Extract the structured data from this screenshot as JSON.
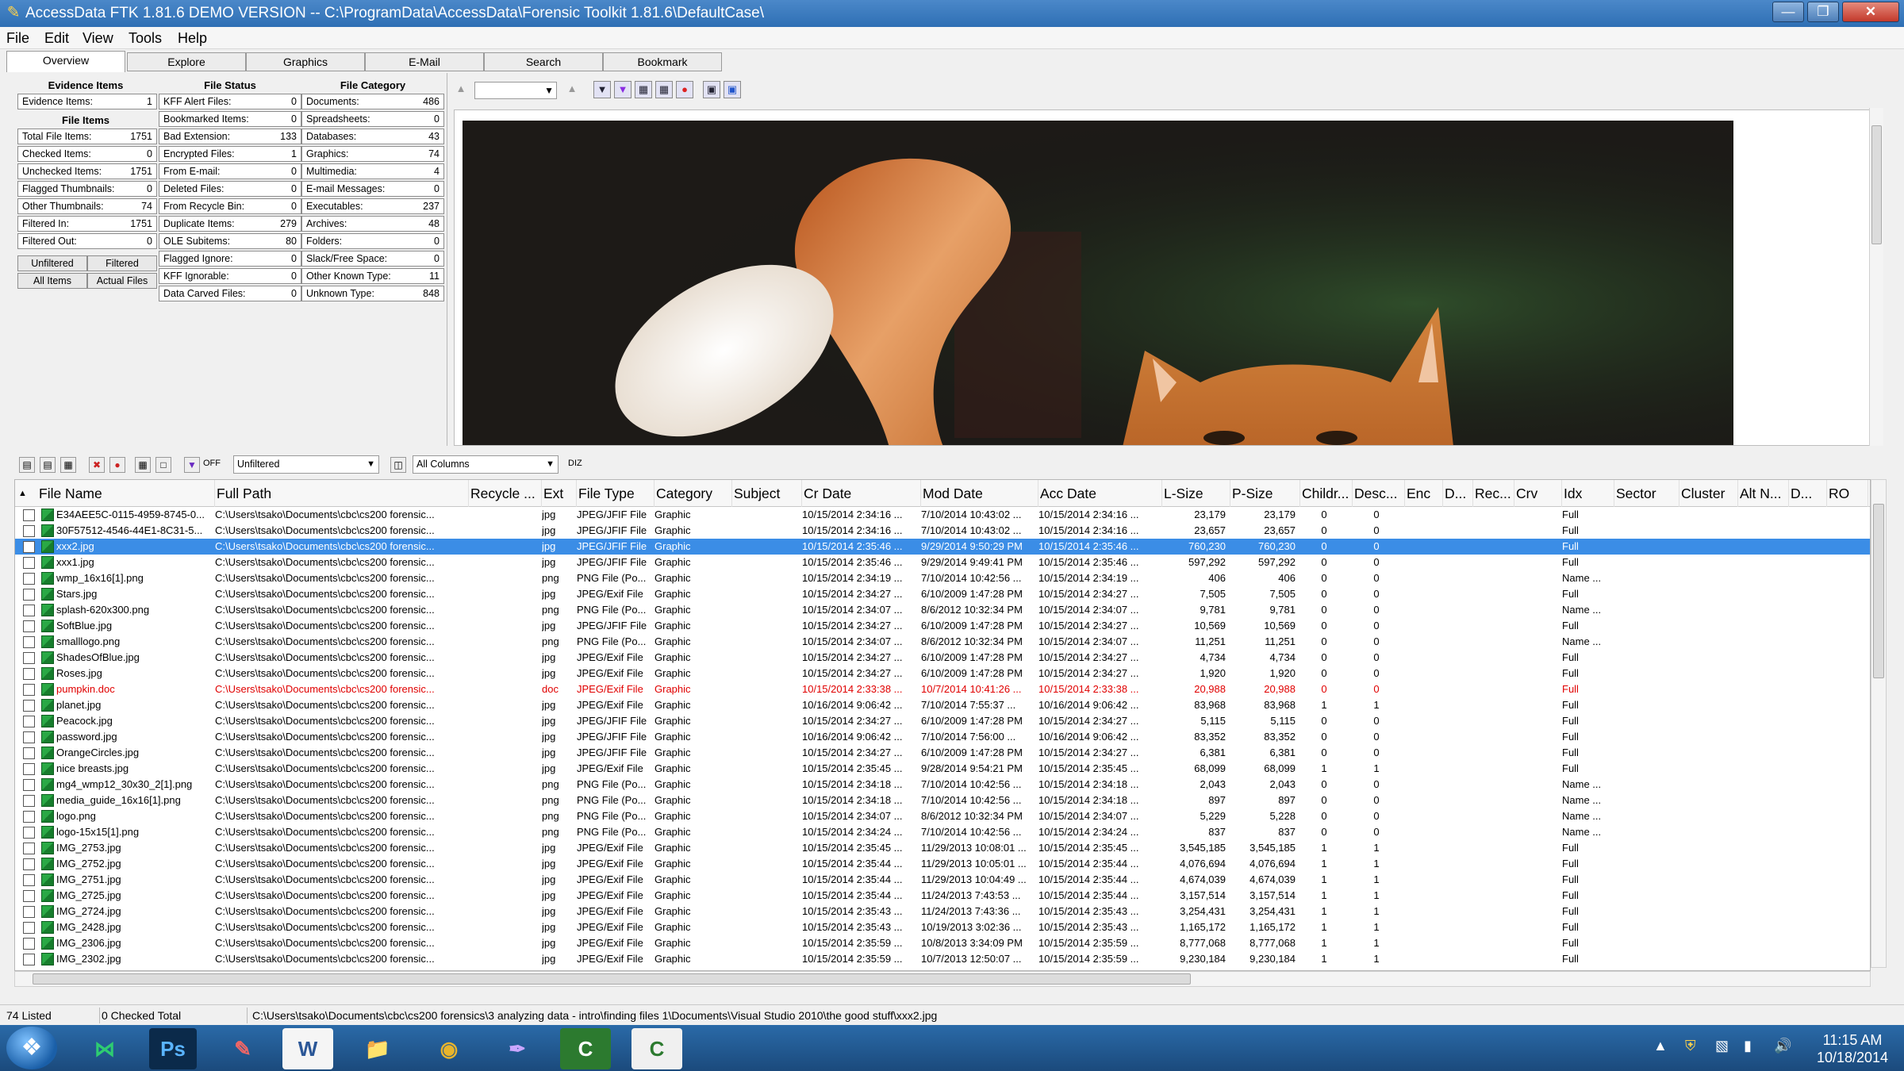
{
  "window": {
    "title": "AccessData FTK 1.81.6 DEMO VERSION -- C:\\ProgramData\\AccessData\\Forensic Toolkit 1.81.6\\DefaultCase\\",
    "min": "—",
    "max": "❐",
    "close": "✕"
  },
  "menu": [
    "File",
    "Edit",
    "View",
    "Tools",
    "Help"
  ],
  "tabs": [
    "Overview",
    "Explore",
    "Graphics",
    "E-Mail",
    "Search",
    "Bookmark"
  ],
  "overview": {
    "evidence_title": "Evidence Items",
    "file_items_title": "File Items",
    "file_status_title": "File Status",
    "file_category_title": "File Category",
    "evidence": [
      {
        "label": "Evidence Items:",
        "value": "1"
      }
    ],
    "file_items": [
      {
        "label": "Total File Items:",
        "value": "1751"
      },
      {
        "label": "Checked Items:",
        "value": "0"
      },
      {
        "label": "Unchecked Items:",
        "value": "1751"
      },
      {
        "label": "Flagged Thumbnails:",
        "value": "0"
      },
      {
        "label": "Other Thumbnails:",
        "value": "74"
      },
      {
        "label": "Filtered In:",
        "value": "1751"
      },
      {
        "label": "Filtered Out:",
        "value": "0"
      }
    ],
    "filter_buttons": [
      "Unfiltered",
      "Filtered"
    ],
    "item_buttons": [
      "All Items",
      "Actual Files"
    ],
    "file_status": [
      {
        "label": "KFF Alert Files:",
        "value": "0"
      },
      {
        "label": "Bookmarked Items:",
        "value": "0"
      },
      {
        "label": "Bad Extension:",
        "value": "133"
      },
      {
        "label": "Encrypted Files:",
        "value": "1"
      },
      {
        "label": "From E-mail:",
        "value": "0"
      },
      {
        "label": "Deleted Files:",
        "value": "0"
      },
      {
        "label": "From Recycle Bin:",
        "value": "0"
      },
      {
        "label": "Duplicate Items:",
        "value": "279"
      },
      {
        "label": "OLE Subitems:",
        "value": "80"
      },
      {
        "label": "Flagged Ignore:",
        "value": "0"
      },
      {
        "label": "KFF Ignorable:",
        "value": "0"
      },
      {
        "label": "Data Carved Files:",
        "value": "0"
      }
    ],
    "file_category": [
      {
        "label": "Documents:",
        "value": "486"
      },
      {
        "label": "Spreadsheets:",
        "value": "0"
      },
      {
        "label": "Databases:",
        "value": "43"
      },
      {
        "label": "Graphics:",
        "value": "74"
      },
      {
        "label": "Multimedia:",
        "value": "4"
      },
      {
        "label": "E-mail Messages:",
        "value": "0"
      },
      {
        "label": "Executables:",
        "value": "237"
      },
      {
        "label": "Archives:",
        "value": "48"
      },
      {
        "label": "Folders:",
        "value": "0"
      },
      {
        "label": "Slack/Free Space:",
        "value": "0"
      },
      {
        "label": "Other Known Type:",
        "value": "11"
      },
      {
        "label": "Unknown Type:",
        "value": "848"
      }
    ]
  },
  "list_toolbar": {
    "filter_value": "Unfiltered",
    "columns_value": "All Columns",
    "off_label": "OFF",
    "diz_label": "DIZ"
  },
  "columns": [
    "File Name",
    "Full Path",
    "Recycle ...",
    "Ext",
    "File Type",
    "Category",
    "Subject",
    "Cr Date",
    "Mod Date",
    "Acc Date",
    "L-Size",
    "P-Size",
    "Childr...",
    "Desc...",
    "Enc",
    "D...",
    "Rec...",
    "Crv",
    "Idx",
    "Sector",
    "Cluster",
    "Alt N...",
    "D...",
    "RO"
  ],
  "rows": [
    {
      "name": "E34AEE5C-0115-4959-8745-0...",
      "path": "C:\\Users\\tsako\\Documents\\cbc\\cs200 forensic...",
      "ext": "jpg",
      "type": "JPEG/JFIF File",
      "cat": "Graphic",
      "cr": "10/15/2014 2:34:16 ...",
      "mod": "7/10/2014 10:43:02 ...",
      "acc": "10/15/2014 2:34:16 ...",
      "ls": "23,179",
      "ps": "23,179",
      "ch": "0",
      "de": "0",
      "idx": "Full"
    },
    {
      "name": "30F57512-4546-44E1-8C31-5...",
      "path": "C:\\Users\\tsako\\Documents\\cbc\\cs200 forensic...",
      "ext": "jpg",
      "type": "JPEG/JFIF File",
      "cat": "Graphic",
      "cr": "10/15/2014 2:34:16 ...",
      "mod": "7/10/2014 10:43:02 ...",
      "acc": "10/15/2014 2:34:16 ...",
      "ls": "23,657",
      "ps": "23,657",
      "ch": "0",
      "de": "0",
      "idx": "Full"
    },
    {
      "name": "xxx2.jpg",
      "path": "C:\\Users\\tsako\\Documents\\cbc\\cs200 forensic...",
      "ext": "jpg",
      "type": "JPEG/JFIF File",
      "cat": "Graphic",
      "cr": "10/15/2014 2:35:46 ...",
      "mod": "9/29/2014 9:50:29 PM",
      "acc": "10/15/2014 2:35:46 ...",
      "ls": "760,230",
      "ps": "760,230",
      "ch": "0",
      "de": "0",
      "idx": "Full",
      "selected": true
    },
    {
      "name": "xxx1.jpg",
      "path": "C:\\Users\\tsako\\Documents\\cbc\\cs200 forensic...",
      "ext": "jpg",
      "type": "JPEG/JFIF File",
      "cat": "Graphic",
      "cr": "10/15/2014 2:35:46 ...",
      "mod": "9/29/2014 9:49:41 PM",
      "acc": "10/15/2014 2:35:46 ...",
      "ls": "597,292",
      "ps": "597,292",
      "ch": "0",
      "de": "0",
      "idx": "Full"
    },
    {
      "name": "wmp_16x16[1].png",
      "path": "C:\\Users\\tsako\\Documents\\cbc\\cs200 forensic...",
      "ext": "png",
      "type": "PNG File (Po...",
      "cat": "Graphic",
      "cr": "10/15/2014 2:34:19 ...",
      "mod": "7/10/2014 10:42:56 ...",
      "acc": "10/15/2014 2:34:19 ...",
      "ls": "406",
      "ps": "406",
      "ch": "0",
      "de": "0",
      "idx": "Name ..."
    },
    {
      "name": "Stars.jpg",
      "path": "C:\\Users\\tsako\\Documents\\cbc\\cs200 forensic...",
      "ext": "jpg",
      "type": "JPEG/Exif File",
      "cat": "Graphic",
      "cr": "10/15/2014 2:34:27 ...",
      "mod": "6/10/2009 1:47:28 PM",
      "acc": "10/15/2014 2:34:27 ...",
      "ls": "7,505",
      "ps": "7,505",
      "ch": "0",
      "de": "0",
      "idx": "Full"
    },
    {
      "name": "splash-620x300.png",
      "path": "C:\\Users\\tsako\\Documents\\cbc\\cs200 forensic...",
      "ext": "png",
      "type": "PNG File (Po...",
      "cat": "Graphic",
      "cr": "10/15/2014 2:34:07 ...",
      "mod": "8/6/2012 10:32:34 PM",
      "acc": "10/15/2014 2:34:07 ...",
      "ls": "9,781",
      "ps": "9,781",
      "ch": "0",
      "de": "0",
      "idx": "Name ..."
    },
    {
      "name": "SoftBlue.jpg",
      "path": "C:\\Users\\tsako\\Documents\\cbc\\cs200 forensic...",
      "ext": "jpg",
      "type": "JPEG/JFIF File",
      "cat": "Graphic",
      "cr": "10/15/2014 2:34:27 ...",
      "mod": "6/10/2009 1:47:28 PM",
      "acc": "10/15/2014 2:34:27 ...",
      "ls": "10,569",
      "ps": "10,569",
      "ch": "0",
      "de": "0",
      "idx": "Full"
    },
    {
      "name": "smalllogo.png",
      "path": "C:\\Users\\tsako\\Documents\\cbc\\cs200 forensic...",
      "ext": "png",
      "type": "PNG File (Po...",
      "cat": "Graphic",
      "cr": "10/15/2014 2:34:07 ...",
      "mod": "8/6/2012 10:32:34 PM",
      "acc": "10/15/2014 2:34:07 ...",
      "ls": "11,251",
      "ps": "11,251",
      "ch": "0",
      "de": "0",
      "idx": "Name ..."
    },
    {
      "name": "ShadesOfBlue.jpg",
      "path": "C:\\Users\\tsako\\Documents\\cbc\\cs200 forensic...",
      "ext": "jpg",
      "type": "JPEG/Exif File",
      "cat": "Graphic",
      "cr": "10/15/2014 2:34:27 ...",
      "mod": "6/10/2009 1:47:28 PM",
      "acc": "10/15/2014 2:34:27 ...",
      "ls": "4,734",
      "ps": "4,734",
      "ch": "0",
      "de": "0",
      "idx": "Full"
    },
    {
      "name": "Roses.jpg",
      "path": "C:\\Users\\tsako\\Documents\\cbc\\cs200 forensic...",
      "ext": "jpg",
      "type": "JPEG/Exif File",
      "cat": "Graphic",
      "cr": "10/15/2014 2:34:27 ...",
      "mod": "6/10/2009 1:47:28 PM",
      "acc": "10/15/2014 2:34:27 ...",
      "ls": "1,920",
      "ps": "1,920",
      "ch": "0",
      "de": "0",
      "idx": "Full"
    },
    {
      "name": "pumpkin.doc",
      "path": "C:\\Users\\tsako\\Documents\\cbc\\cs200 forensic...",
      "ext": "doc",
      "type": "JPEG/Exif File",
      "cat": "Graphic",
      "cr": "10/15/2014 2:33:38 ...",
      "mod": "10/7/2014 10:41:26 ...",
      "acc": "10/15/2014 2:33:38 ...",
      "ls": "20,988",
      "ps": "20,988",
      "ch": "0",
      "de": "0",
      "idx": "Full",
      "red": true
    },
    {
      "name": "planet.jpg",
      "path": "C:\\Users\\tsako\\Documents\\cbc\\cs200 forensic...",
      "ext": "jpg",
      "type": "JPEG/Exif File",
      "cat": "Graphic",
      "cr": "10/16/2014 9:06:42 ...",
      "mod": "7/10/2014 7:55:37 ...",
      "acc": "10/16/2014 9:06:42 ...",
      "ls": "83,968",
      "ps": "83,968",
      "ch": "1",
      "de": "1",
      "idx": "Full"
    },
    {
      "name": "Peacock.jpg",
      "path": "C:\\Users\\tsako\\Documents\\cbc\\cs200 forensic...",
      "ext": "jpg",
      "type": "JPEG/JFIF File",
      "cat": "Graphic",
      "cr": "10/15/2014 2:34:27 ...",
      "mod": "6/10/2009 1:47:28 PM",
      "acc": "10/15/2014 2:34:27 ...",
      "ls": "5,115",
      "ps": "5,115",
      "ch": "0",
      "de": "0",
      "idx": "Full"
    },
    {
      "name": "password.jpg",
      "path": "C:\\Users\\tsako\\Documents\\cbc\\cs200 forensic...",
      "ext": "jpg",
      "type": "JPEG/JFIF File",
      "cat": "Graphic",
      "cr": "10/16/2014 9:06:42 ...",
      "mod": "7/10/2014 7:56:00 ...",
      "acc": "10/16/2014 9:06:42 ...",
      "ls": "83,352",
      "ps": "83,352",
      "ch": "0",
      "de": "0",
      "idx": "Full"
    },
    {
      "name": "OrangeCircles.jpg",
      "path": "C:\\Users\\tsako\\Documents\\cbc\\cs200 forensic...",
      "ext": "jpg",
      "type": "JPEG/JFIF File",
      "cat": "Graphic",
      "cr": "10/15/2014 2:34:27 ...",
      "mod": "6/10/2009 1:47:28 PM",
      "acc": "10/15/2014 2:34:27 ...",
      "ls": "6,381",
      "ps": "6,381",
      "ch": "0",
      "de": "0",
      "idx": "Full"
    },
    {
      "name": "nice breasts.jpg",
      "path": "C:\\Users\\tsako\\Documents\\cbc\\cs200 forensic...",
      "ext": "jpg",
      "type": "JPEG/Exif File",
      "cat": "Graphic",
      "cr": "10/15/2014 2:35:45 ...",
      "mod": "9/28/2014 9:54:21 PM",
      "acc": "10/15/2014 2:35:45 ...",
      "ls": "68,099",
      "ps": "68,099",
      "ch": "1",
      "de": "1",
      "idx": "Full"
    },
    {
      "name": "mg4_wmp12_30x30_2[1].png",
      "path": "C:\\Users\\tsako\\Documents\\cbc\\cs200 forensic...",
      "ext": "png",
      "type": "PNG File (Po...",
      "cat": "Graphic",
      "cr": "10/15/2014 2:34:18 ...",
      "mod": "7/10/2014 10:42:56 ...",
      "acc": "10/15/2014 2:34:18 ...",
      "ls": "2,043",
      "ps": "2,043",
      "ch": "0",
      "de": "0",
      "idx": "Name ..."
    },
    {
      "name": "media_guide_16x16[1].png",
      "path": "C:\\Users\\tsako\\Documents\\cbc\\cs200 forensic...",
      "ext": "png",
      "type": "PNG File (Po...",
      "cat": "Graphic",
      "cr": "10/15/2014 2:34:18 ...",
      "mod": "7/10/2014 10:42:56 ...",
      "acc": "10/15/2014 2:34:18 ...",
      "ls": "897",
      "ps": "897",
      "ch": "0",
      "de": "0",
      "idx": "Name ..."
    },
    {
      "name": "logo.png",
      "path": "C:\\Users\\tsako\\Documents\\cbc\\cs200 forensic...",
      "ext": "png",
      "type": "PNG File (Po...",
      "cat": "Graphic",
      "cr": "10/15/2014 2:34:07 ...",
      "mod": "8/6/2012 10:32:34 PM",
      "acc": "10/15/2014 2:34:07 ...",
      "ls": "5,229",
      "ps": "5,228",
      "ch": "0",
      "de": "0",
      "idx": "Name ..."
    },
    {
      "name": "logo-15x15[1].png",
      "path": "C:\\Users\\tsako\\Documents\\cbc\\cs200 forensic...",
      "ext": "png",
      "type": "PNG File (Po...",
      "cat": "Graphic",
      "cr": "10/15/2014 2:34:24 ...",
      "mod": "7/10/2014 10:42:56 ...",
      "acc": "10/15/2014 2:34:24 ...",
      "ls": "837",
      "ps": "837",
      "ch": "0",
      "de": "0",
      "idx": "Name ..."
    },
    {
      "name": "IMG_2753.jpg",
      "path": "C:\\Users\\tsako\\Documents\\cbc\\cs200 forensic...",
      "ext": "jpg",
      "type": "JPEG/Exif File",
      "cat": "Graphic",
      "cr": "10/15/2014 2:35:45 ...",
      "mod": "11/29/2013 10:08:01 ...",
      "acc": "10/15/2014 2:35:45 ...",
      "ls": "3,545,185",
      "ps": "3,545,185",
      "ch": "1",
      "de": "1",
      "idx": "Full"
    },
    {
      "name": "IMG_2752.jpg",
      "path": "C:\\Users\\tsako\\Documents\\cbc\\cs200 forensic...",
      "ext": "jpg",
      "type": "JPEG/Exif File",
      "cat": "Graphic",
      "cr": "10/15/2014 2:35:44 ...",
      "mod": "11/29/2013 10:05:01 ...",
      "acc": "10/15/2014 2:35:44 ...",
      "ls": "4,076,694",
      "ps": "4,076,694",
      "ch": "1",
      "de": "1",
      "idx": "Full"
    },
    {
      "name": "IMG_2751.jpg",
      "path": "C:\\Users\\tsako\\Documents\\cbc\\cs200 forensic...",
      "ext": "jpg",
      "type": "JPEG/Exif File",
      "cat": "Graphic",
      "cr": "10/15/2014 2:35:44 ...",
      "mod": "11/29/2013 10:04:49 ...",
      "acc": "10/15/2014 2:35:44 ...",
      "ls": "4,674,039",
      "ps": "4,674,039",
      "ch": "1",
      "de": "1",
      "idx": "Full"
    },
    {
      "name": "IMG_2725.jpg",
      "path": "C:\\Users\\tsako\\Documents\\cbc\\cs200 forensic...",
      "ext": "jpg",
      "type": "JPEG/Exif File",
      "cat": "Graphic",
      "cr": "10/15/2014 2:35:44 ...",
      "mod": "11/24/2013 7:43:53 ...",
      "acc": "10/15/2014 2:35:44 ...",
      "ls": "3,157,514",
      "ps": "3,157,514",
      "ch": "1",
      "de": "1",
      "idx": "Full"
    },
    {
      "name": "IMG_2724.jpg",
      "path": "C:\\Users\\tsako\\Documents\\cbc\\cs200 forensic...",
      "ext": "jpg",
      "type": "JPEG/Exif File",
      "cat": "Graphic",
      "cr": "10/15/2014 2:35:43 ...",
      "mod": "11/24/2013 7:43:36 ...",
      "acc": "10/15/2014 2:35:43 ...",
      "ls": "3,254,431",
      "ps": "3,254,431",
      "ch": "1",
      "de": "1",
      "idx": "Full"
    },
    {
      "name": "IMG_2428.jpg",
      "path": "C:\\Users\\tsako\\Documents\\cbc\\cs200 forensic...",
      "ext": "jpg",
      "type": "JPEG/Exif File",
      "cat": "Graphic",
      "cr": "10/15/2014 2:35:43 ...",
      "mod": "10/19/2013 3:02:36 ...",
      "acc": "10/15/2014 2:35:43 ...",
      "ls": "1,165,172",
      "ps": "1,165,172",
      "ch": "1",
      "de": "1",
      "idx": "Full"
    },
    {
      "name": "IMG_2306.jpg",
      "path": "C:\\Users\\tsako\\Documents\\cbc\\cs200 forensic...",
      "ext": "jpg",
      "type": "JPEG/Exif File",
      "cat": "Graphic",
      "cr": "10/15/2014 2:35:59 ...",
      "mod": "10/8/2013 3:34:09 PM",
      "acc": "10/15/2014 2:35:59 ...",
      "ls": "8,777,068",
      "ps": "8,777,068",
      "ch": "1",
      "de": "1",
      "idx": "Full"
    },
    {
      "name": "IMG_2302.jpg",
      "path": "C:\\Users\\tsako\\Documents\\cbc\\cs200 forensic...",
      "ext": "jpg",
      "type": "JPEG/Exif File",
      "cat": "Graphic",
      "cr": "10/15/2014 2:35:59 ...",
      "mod": "10/7/2013 12:50:07 ...",
      "acc": "10/15/2014 2:35:59 ...",
      "ls": "9,230,184",
      "ps": "9,230,184",
      "ch": "1",
      "de": "1",
      "idx": "Full"
    }
  ],
  "status": {
    "listed": "74 Listed",
    "checked": "0 Checked Total",
    "path": "C:\\Users\\tsako\\Documents\\cbc\\cs200 forensics\\3 analyzing data - intro\\finding files 1\\Documents\\Visual Studio 2010\\the good stuff\\xxx2.jpg"
  },
  "taskbar": {
    "apps": [
      "visual-studio-icon",
      "photoshop-icon",
      "paint-icon",
      "word-icon",
      "file-explorer-icon",
      "chrome-icon",
      "feather-pen-icon",
      "camtasia-recorder-icon",
      "camtasia-studio-icon"
    ],
    "time": "11:15 AM",
    "date": "10/18/2014"
  }
}
